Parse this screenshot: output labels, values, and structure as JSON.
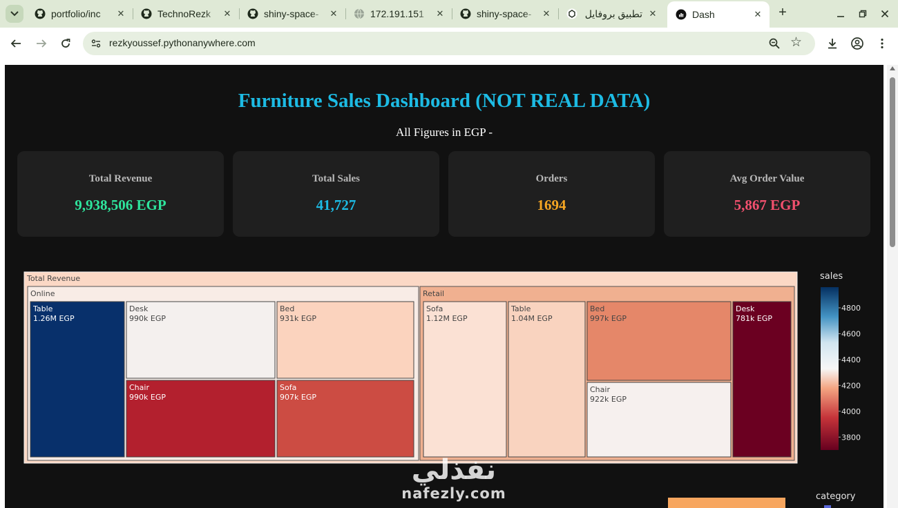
{
  "browser": {
    "tabs": [
      {
        "title": "portfolio/inc",
        "favicon": "github-icon"
      },
      {
        "title": "TechnoRezk",
        "favicon": "github-icon"
      },
      {
        "title": "shiny-space-",
        "favicon": "github-icon"
      },
      {
        "title": "172.191.151",
        "favicon": "globe-icon"
      },
      {
        "title": "shiny-space-",
        "favicon": "github-icon"
      },
      {
        "title": "تطبيق بروفايل",
        "favicon": "chatgpt-icon"
      },
      {
        "title": "Dash",
        "favicon": "dash-icon",
        "active": true
      }
    ],
    "close_glyph": "✕",
    "new_tab_glyph": "+",
    "url": "rezkyoussef.pythonanywhere.com"
  },
  "dashboard": {
    "title": "Furniture Sales Dashboard (NOT REAL DATA)",
    "subtitle": "All Figures in EGP -",
    "cards": [
      {
        "label": "Total Revenue",
        "value": "9,938,506 EGP",
        "color": "#2ee59d"
      },
      {
        "label": "Total Sales",
        "value": "41,727",
        "color": "#1dbbe4"
      },
      {
        "label": "Orders",
        "value": "1694",
        "color": "#f5a623"
      },
      {
        "label": "Avg Order Value",
        "value": "5,867 EGP",
        "color": "#f2506e"
      }
    ]
  },
  "chart_data": {
    "type": "treemap",
    "root": "Total Revenue",
    "value_metric": "revenue (EGP)",
    "color_metric": "sales",
    "colorscale": "RdBu",
    "colorbar": {
      "title": "sales",
      "ticks": [
        4800,
        4600,
        4400,
        4200,
        4000,
        3800
      ],
      "range": [
        3700,
        4960
      ]
    },
    "groups": [
      {
        "name": "Online",
        "items": [
          {
            "name": "Table",
            "label": "1.26M EGP",
            "value": 1260000,
            "color": "#08306b"
          },
          {
            "name": "Desk",
            "label": "990k EGP",
            "value": 990000,
            "color": "#f4f0ee"
          },
          {
            "name": "Chair",
            "label": "990k EGP",
            "value": 990000,
            "color": "#b3202e"
          },
          {
            "name": "Bed",
            "label": "931k EGP",
            "value": 931000,
            "color": "#fbd3be"
          },
          {
            "name": "Sofa",
            "label": "907k EGP",
            "value": 907000,
            "color": "#cc4c43"
          }
        ]
      },
      {
        "name": "Retail",
        "items": [
          {
            "name": "Sofa",
            "label": "1.12M EGP",
            "value": 1120000,
            "color": "#fbe1d4"
          },
          {
            "name": "Table",
            "label": "1.04M EGP",
            "value": 1040000,
            "color": "#f9d3bf"
          },
          {
            "name": "Bed",
            "label": "997k EGP",
            "value": 997000,
            "color": "#e58769"
          },
          {
            "name": "Chair",
            "label": "922k EGP",
            "value": 922000,
            "color": "#f6f0ee"
          },
          {
            "name": "Desk",
            "label": "781k EGP",
            "value": 781000,
            "color": "#6b0021"
          }
        ]
      }
    ]
  },
  "second_chart": {
    "legend_title": "category"
  },
  "watermark": {
    "arabic": "نفذلي",
    "latin": "nafezly.com"
  }
}
